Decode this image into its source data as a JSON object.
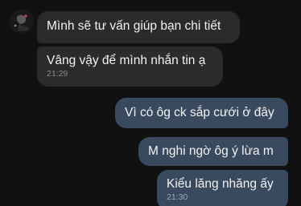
{
  "messages": [
    {
      "text": "Mình sẽ tư vấn giúp bạn chi tiết",
      "time": ""
    },
    {
      "text": "Vâng vậy để mình nhắn tin ạ",
      "time": "21:29"
    },
    {
      "text": "Vì có ôg ck sắp cưới ở đây",
      "time": ""
    },
    {
      "text": "M nghi ngờ ôg ý lừa m",
      "time": ""
    },
    {
      "text": "Kiểu lăng nhăng ấy",
      "time": "21:30"
    }
  ]
}
